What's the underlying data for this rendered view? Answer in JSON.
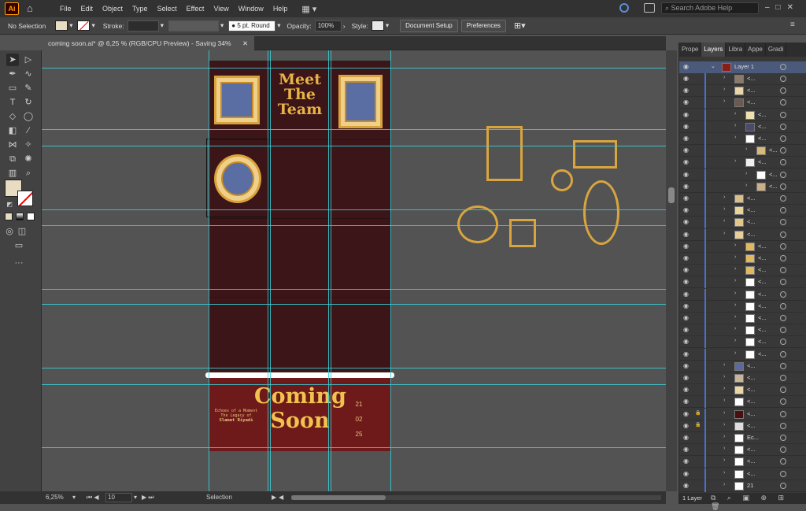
{
  "menubar": {
    "logo": "Ai",
    "items": [
      "File",
      "Edit",
      "Object",
      "Type",
      "Select",
      "Effect",
      "View",
      "Window",
      "Help"
    ],
    "search_placeholder": "Search Adobe Help"
  },
  "control_bar": {
    "selection": "No Selection",
    "stroke_label": "Stroke:",
    "brush": "5 pt. Round",
    "opacity_label": "Opacity:",
    "opacity_value": "100%",
    "style_label": "Style:",
    "document_setup": "Document Setup",
    "preferences": "Preferences"
  },
  "document_tab": {
    "title": "coming soon.ai* @ 6,25 % (RGB/CPU Preview)  - Saving 34%"
  },
  "artboard": {
    "title_line1": "Meet",
    "title_line2": "The",
    "title_line3": "Team",
    "coming": "Coming",
    "soon": "Soon",
    "school_line1": "Echoes of a Moment",
    "school_line2": "The Legacy of",
    "school_line3": "Slamet Riyadi",
    "date_day": "21",
    "date_month": "02",
    "date_year": "25"
  },
  "status_bar": {
    "zoom": "6,25%",
    "page": "10",
    "tool": "Selection"
  },
  "layers_panel": {
    "tabs": [
      "Prope",
      "Layers",
      "Libra",
      "Appe",
      "Gradi"
    ],
    "layer_name": "Layer 1",
    "sublabel": "<...",
    "footer_count": "1 Layer",
    "ec_label": "Ec...",
    "bottom_label": "21"
  },
  "colors": {
    "accent": "#39d0d8",
    "artboard": "#3c1518",
    "gold": "#d9a23b"
  }
}
